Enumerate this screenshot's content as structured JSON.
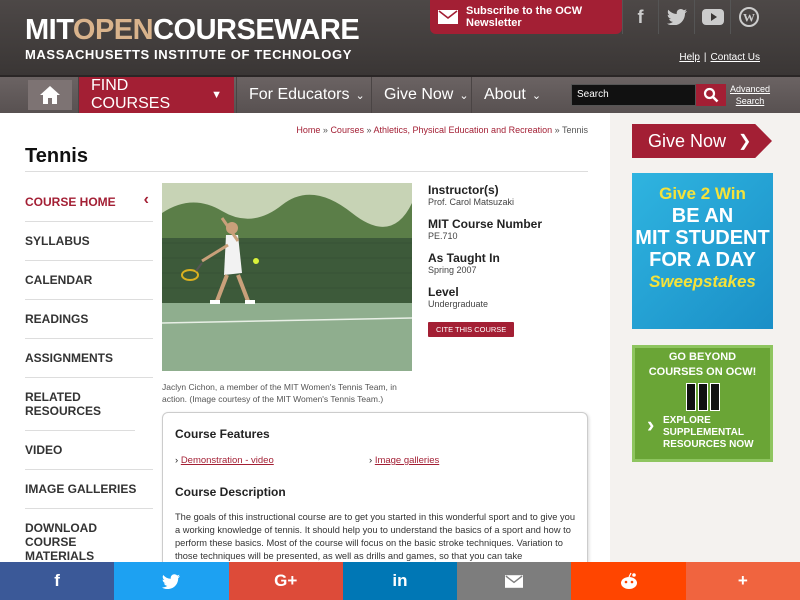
{
  "header": {
    "logo_mit": "MIT",
    "logo_open": "OPEN",
    "logo_courseware": "COURSEWARE",
    "logo_sub": "MASSACHUSETTS INSTITUTE OF TECHNOLOGY",
    "subscribe_label": "Subscribe to the OCW Newsletter",
    "social": [
      "f",
      "t",
      "▶",
      "W"
    ],
    "help_label": "Help",
    "contact_label": "Contact Us"
  },
  "nav": {
    "items": [
      {
        "label": "FIND COURSES"
      },
      {
        "label": "For Educators"
      },
      {
        "label": "Give Now"
      },
      {
        "label": "About"
      }
    ],
    "search_placeholder": "Search",
    "advanced_line1": "Advanced",
    "advanced_line2": "Search"
  },
  "breadcrumb": {
    "home": "Home",
    "courses": "Courses",
    "dept": "Athletics, Physical Education and Recreation",
    "current": "Tennis",
    "sep": "»"
  },
  "course": {
    "title": "Tennis",
    "caption": "Jaclyn Cichon, a member of the MIT Women's Tennis Team, in action. (Image courtesy of the MIT Women's Tennis Team.)",
    "instructor_heading": "Instructor(s)",
    "instructor": "Prof. Carol Matsuzaki",
    "number_heading": "MIT Course Number",
    "number": "PE.710",
    "taught_heading": "As Taught In",
    "taught": "Spring 2007",
    "level_heading": "Level",
    "level": "Undergraduate",
    "cite_label": "CITE THIS COURSE"
  },
  "sidenav": [
    {
      "label": "COURSE HOME"
    },
    {
      "label": "SYLLABUS"
    },
    {
      "label": "CALENDAR"
    },
    {
      "label": "READINGS"
    },
    {
      "label": "ASSIGNMENTS"
    },
    {
      "label": "RELATED RESOURCES"
    },
    {
      "label": "VIDEO"
    },
    {
      "label": "IMAGE GALLERIES"
    },
    {
      "label": "DOWNLOAD COURSE MATERIALS"
    }
  ],
  "features": {
    "heading": "Course Features",
    "items": [
      "Demonstration - video",
      "Image galleries"
    ]
  },
  "description": {
    "heading": "Course Description",
    "text": "The goals of this instructional course are to get you started in this wonderful sport and to give you a working knowledge of tennis. It should help you to understand the basics of a sport and how to perform these basics. Most of the course will focus on the basic stroke techniques. Variation to those techniques will be presented, as well as drills and games, so that you can take"
  },
  "sidebar": {
    "give_now": "Give Now",
    "promo1_lines": [
      "Give 2 Win",
      "BE AN",
      "MIT STUDENT",
      "FOR A DAY",
      "Sweepstakes"
    ],
    "promo2_top1": "GO BEYOND",
    "promo2_top2": "COURSES ON OCW!",
    "promo2_b1": "EXPLORE",
    "promo2_b2": "SUPPLEMENTAL",
    "promo2_b3": "RESOURCES NOW"
  },
  "share": {
    "items": [
      {
        "label": "f",
        "color": "#3b5998"
      },
      {
        "label": "🐦",
        "color": "#1da1f2"
      },
      {
        "label": "G+",
        "color": "#dd4b39"
      },
      {
        "label": "in",
        "color": "#0077b5"
      },
      {
        "label": "✉",
        "color": "#7d7d7d"
      },
      {
        "label": "👽",
        "color": "#ff4500"
      },
      {
        "label": "+",
        "color": "#f0643f"
      }
    ]
  },
  "colors": {
    "brand": "#a31f34"
  }
}
